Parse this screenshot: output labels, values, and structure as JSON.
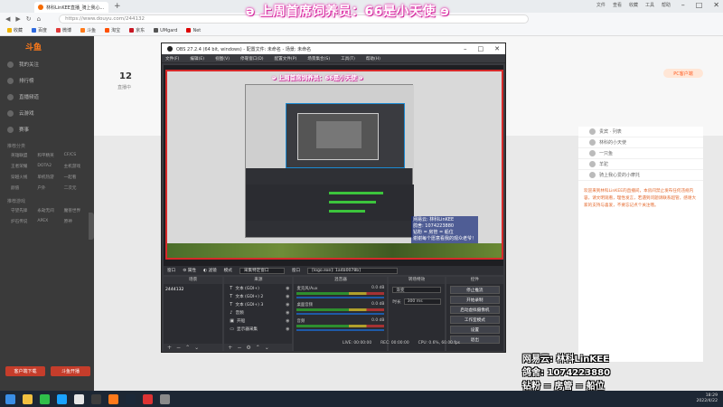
{
  "browser": {
    "tab_title": "林科LinKEE直播_骑上我心...",
    "new_tab": "+",
    "url": "https://www.douyu.com/244132",
    "right_menu": [
      "文件",
      "查看",
      "收藏",
      "工具",
      "帮助"
    ],
    "window_controls": [
      "–",
      "□",
      "✕"
    ],
    "bookmarks": [
      "收藏",
      "百度",
      "微博",
      "斗鱼",
      "淘宝",
      "京东",
      "UMgard",
      "Net"
    ]
  },
  "douyu": {
    "logo": "斗鱼",
    "sidebar": {
      "items": [
        "我的关注",
        "排行榜",
        "直播频道",
        "云游戏",
        "赛事"
      ],
      "section_title": "推荐分类",
      "grid": [
        "英雄联盟",
        "和平精英",
        "CF/CS",
        "王者荣耀",
        "DOTA2",
        "主机游戏",
        "穿越火线",
        "单机热游",
        "一起看",
        "颜值",
        "户外",
        "二次元"
      ],
      "section2_title": "推荐游戏",
      "grid2": [
        "守望先锋",
        "永劫无间",
        "魔兽世界",
        "炉石传说",
        "APEX",
        "原神"
      ],
      "buttons": [
        "客户端下载",
        "斗鱼开播"
      ]
    },
    "header": {
      "count": "12",
      "sub": "直播中",
      "pc_client": "PC客户端"
    },
    "rank_rows": [
      "贵宾 · 列表",
      "林科的小天使",
      "一只鱼",
      "羊驼",
      "骑上我心爱的小摩托"
    ],
    "chat_text": "欢迎来到林科LinKEE的直播间，本房间禁止发布任何违规内容，请文明观看，理性发言，若遇到问题请联系超管，感谢大家的支持与喜爱，不要忘记点个关注哦。"
  },
  "stream_overlay": {
    "banner": "ə 上周首席饲养员：66是小天使 ɘ",
    "info": [
      "网易云: 林科LinKEE",
      "鸽舍: 1074223880",
      "钻粉 = 房管 = 船位",
      "谢谢每个愿意看我的观众老爷！"
    ]
  },
  "obs": {
    "title": "OBS 27.2.4 (64 bit, windows) - 配置文件: 未命名 - 场景: 未命名",
    "menu": [
      "文件(F)",
      "编辑(E)",
      "视图(V)",
      "停靠窗口(D)",
      "配置文件(P)",
      "场景集合(S)",
      "工具(T)",
      "帮助(H)"
    ],
    "canvas_banner": "ə 上周首席饲养员：66是小天使 ɘ",
    "canvas_info": [
      "网易云: 林科LinKEE",
      "鸽舍: 1074223880",
      "钻粉 = 房管 = 船位",
      "谢谢每个愿意看我的观众老爷！"
    ],
    "toolbar": {
      "label": "窗口",
      "props": "属性",
      "filters": "滤镜",
      "mode": "模式",
      "mode_value": "采集特定窗口",
      "window_label": "窗口",
      "window_value": "[logo.exe]: 1a4b0078b]"
    },
    "docks": {
      "scenes_header": "场景",
      "scene": "2444132",
      "sources_header": "来源",
      "sources": [
        "文本 (GDI+)",
        "文本 (GDI+) 2",
        "文本 (GDI+) 3",
        "音频",
        "开船",
        "显示器采集"
      ],
      "mixer_header": "混音器",
      "mixer": [
        {
          "name": "麦克风/Aux",
          "db": "0.0 dB"
        },
        {
          "name": "桌面音频",
          "db": "0.0 dB"
        },
        {
          "name": "音频",
          "db": "0.0 dB"
        }
      ],
      "transitions_header": "转场特效",
      "transition_value": "渐变",
      "duration_label": "时长",
      "duration_value": "300 ms",
      "controls_header": "控件",
      "controls": [
        "停止推流",
        "开始录制",
        "启动虚拟摄像机",
        "工作室模式",
        "设置",
        "退出"
      ]
    },
    "status": [
      "LIVE: 00:00:00",
      "REC: 00:00:00",
      "CPU: 0.6%, 60.00 fps"
    ]
  },
  "taskbar": {
    "time": "18:29",
    "date": "2022/4/22"
  }
}
